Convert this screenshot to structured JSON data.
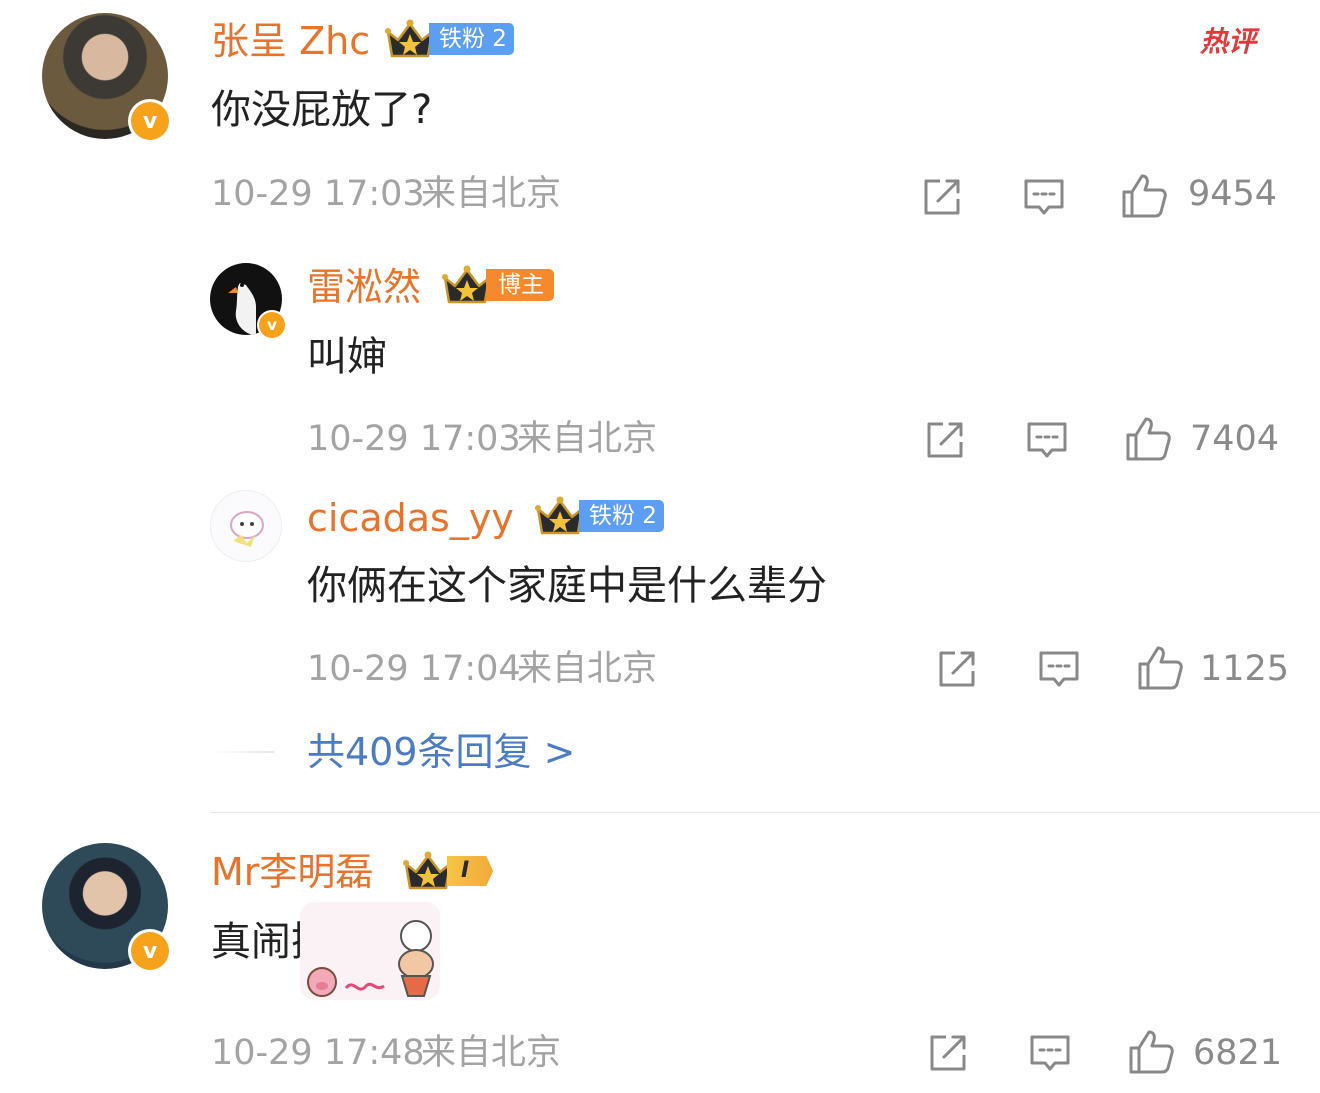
{
  "hot_tag": "热评",
  "comments": [
    {
      "username": "张呈 Zhc",
      "crown_level": "II",
      "fan_badge": "铁粉 2",
      "text": "你没屁放了?",
      "time": "10-29 17:03",
      "location": "来自北京",
      "likes": "9454",
      "replies": [
        {
          "username": "雷淞然",
          "crown_level": "II",
          "badge": "博主",
          "text": "叫婶",
          "time": "10-29 17:03",
          "location": "来自北京",
          "likes": "7404"
        },
        {
          "username": "cicadas_yy",
          "crown_level": "5",
          "fan_badge": "铁粉 2",
          "text": "你俩在这个家庭中是什么辈分",
          "time": "10-29 17:04",
          "location": "来自北京",
          "likes": "1125"
        }
      ],
      "more_replies": "共409条回复 >"
    },
    {
      "username": "Mr李明磊",
      "crown_level": "I",
      "text": "真闹挺",
      "time": "10-29 17:48",
      "location": "来自北京",
      "likes": "6821"
    }
  ],
  "colors": {
    "username": "#e8732a",
    "link": "#4a7bc4",
    "meta": "#a3a3a3",
    "verified": "#f7a21b",
    "fan_badge": "#5c9ef2"
  }
}
